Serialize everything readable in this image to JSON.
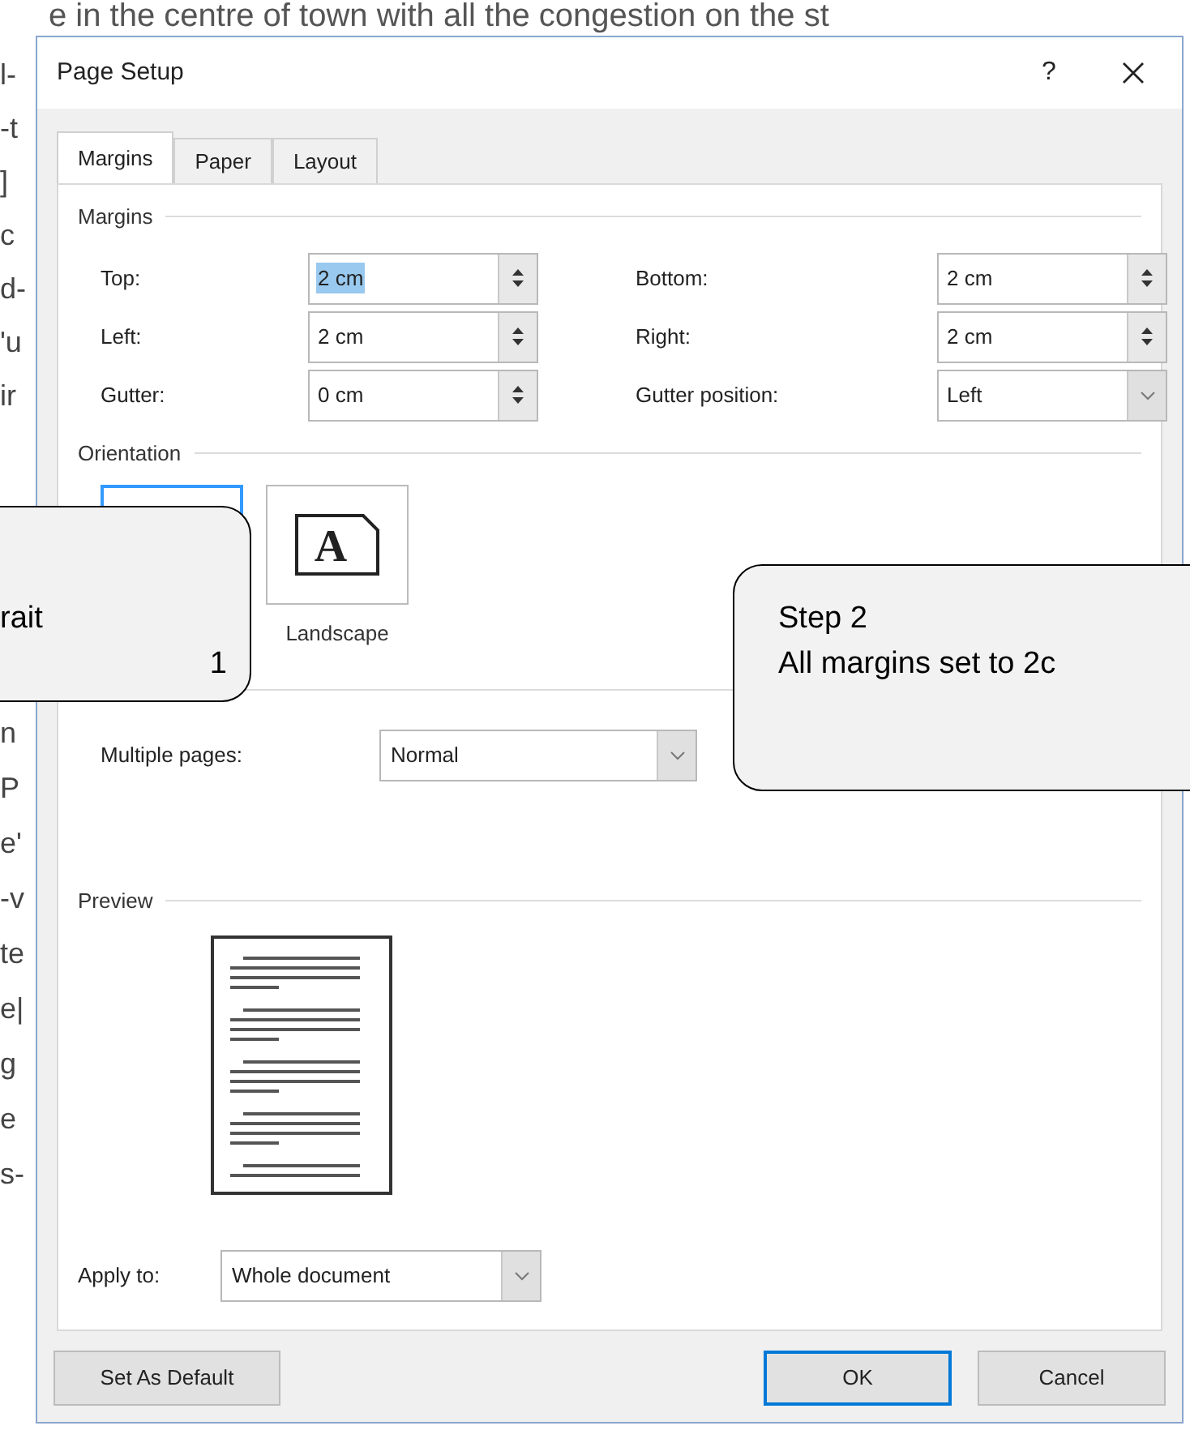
{
  "background_document": {
    "top_line": "e in the centre of town with all the congestion on the st",
    "fragments_upper": [
      "l-",
      "-t",
      "]",
      "c",
      "d-",
      "'u",
      "ir"
    ],
    "fragments_lower": [
      "n",
      "P",
      "e'",
      "-v",
      "te",
      "e|",
      "g",
      "e",
      "s-"
    ]
  },
  "window": {
    "title": "Page Setup",
    "help": "?"
  },
  "tabs": [
    {
      "label": "Margins",
      "selected": true
    },
    {
      "label": "Paper",
      "selected": false
    },
    {
      "label": "Layout",
      "selected": false
    }
  ],
  "margins": {
    "heading": "Margins",
    "fields": [
      {
        "label": "Top:",
        "value": "2 cm",
        "kind": "spinner",
        "highlighted": true
      },
      {
        "label": "Bottom:",
        "value": "2 cm",
        "kind": "spinner",
        "highlighted": false
      },
      {
        "label": "Left:",
        "value": "2 cm",
        "kind": "spinner",
        "highlighted": false
      },
      {
        "label": "Right:",
        "value": "2 cm",
        "kind": "spinner",
        "highlighted": false
      },
      {
        "label": "Gutter:",
        "value": "0 cm",
        "kind": "spinner",
        "highlighted": false
      },
      {
        "label": "Gutter position:",
        "value": "Left",
        "kind": "dropdown",
        "highlighted": false
      }
    ]
  },
  "orientation": {
    "heading": "Orientation",
    "options": [
      {
        "kind": "portrait",
        "selected": true
      },
      {
        "kind": "landscape",
        "label": "Landscape",
        "glyph": "A",
        "selected": false
      }
    ]
  },
  "multiple_pages": {
    "label": "Multiple pages:",
    "value": "Normal"
  },
  "preview": {
    "heading": "Preview"
  },
  "apply_to": {
    "label": "Apply to:",
    "value": "Whole document"
  },
  "buttons": [
    {
      "label": "Set As Default",
      "default": false
    },
    {
      "label": "OK",
      "default": true
    },
    {
      "label": "Cancel",
      "default": false
    }
  ],
  "callouts": [
    {
      "kind": "cut-left",
      "lines": [
        "rait",
        "1"
      ]
    },
    {
      "kind": "plain",
      "lines": [
        "Step 2",
        "All margins set to 2c"
      ]
    }
  ]
}
